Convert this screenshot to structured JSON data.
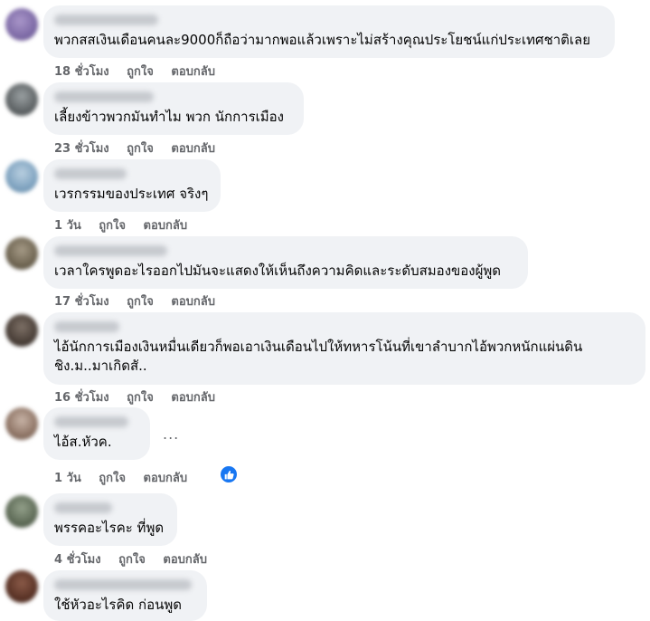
{
  "comments": [
    {
      "text": "พวกสสเงินเดือนคนละ9000ก็ถือว่ามากพอแล้วเพราะไม่สร้างคุณประโยชน์แก่ประเทศชาติเลย",
      "time": "18 ชั่วโมง",
      "like": "ถูกใจ",
      "reply": "ตอบกลับ"
    },
    {
      "text": "เลี้ยงข้าวพวกมันทำไม พวก นักการเมือง",
      "time": "23 ชั่วโมง",
      "like": "ถูกใจ",
      "reply": "ตอบกลับ"
    },
    {
      "text": "เวรกรรมของประเทศ จริงๆ",
      "time": "1 วัน",
      "like": "ถูกใจ",
      "reply": "ตอบกลับ"
    },
    {
      "text": "เวลาใครพูดอะไรออกไปมันจะแสดงให้เห็นถึงความคิดและระดับสมองของผู้พูด",
      "time": "17 ชั่วโมง",
      "like": "ถูกใจ",
      "reply": "ตอบกลับ"
    },
    {
      "text": "ไอ้นักการเมืองเงินหมื่นเดียวก็พอเอาเงินเดือนไปให้ทหารโน้นที่เขาลำบากไอ้พวกหนักแผ่นดิน\nชิง.ม..มาเกิดสั..",
      "time": "16 ชั่วโมง",
      "like": "ถูกใจ",
      "reply": "ตอบกลับ"
    },
    {
      "text": "ไอ้ส.หัวค.",
      "time": "1 วัน",
      "like": "ถูกใจ",
      "reply": "ตอบกลับ",
      "more": "...",
      "reaction_icon": "like-reaction-icon"
    },
    {
      "text": "พรรคอะไรคะ ที่พูด",
      "time": "4 ชั่วโมง",
      "like": "ถูกใจ",
      "reply": "ตอบกลับ"
    },
    {
      "text": "ใช้หัวอะไรคิด ก่อนพูด"
    }
  ],
  "colors": {
    "bubble": "#f0f2f5",
    "meta": "#65676b",
    "like_blue": "#1877f2"
  }
}
